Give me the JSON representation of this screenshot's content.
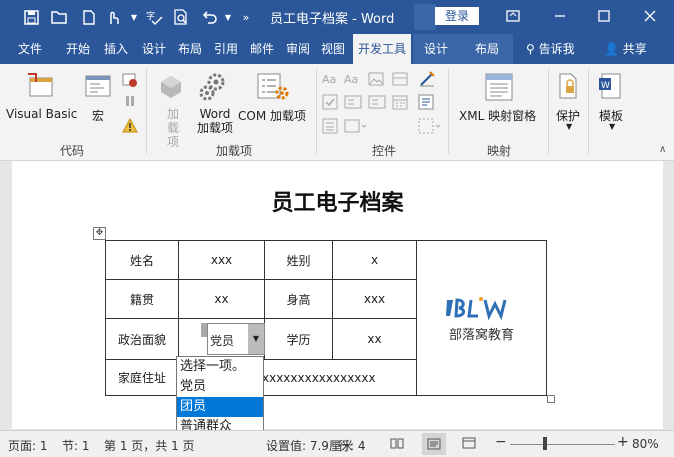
{
  "window": {
    "title": "员工电子档案  -  Word",
    "login": "登录",
    "accent": "#2b579a"
  },
  "tabs": [
    "文件",
    "开始",
    "插入",
    "设计",
    "布局",
    "引用",
    "邮件",
    "审阅",
    "视图",
    "开发工具",
    "设计",
    "布局"
  ],
  "tell_me": "告诉我",
  "share": "共享",
  "ribbon": {
    "code": {
      "label": "代码",
      "visual_basic": "Visual Basic",
      "macro": "宏"
    },
    "addins": {
      "label": "加载项",
      "addins": "加\n载项",
      "word_addins": "Word\n加载项",
      "com_addins": "COM 加载项"
    },
    "controls": {
      "label": "控件"
    },
    "mapping": {
      "label": "映射",
      "xml_pane": "XML 映射窗格"
    },
    "protect": {
      "label": "保护"
    },
    "templates": {
      "label": "模板"
    }
  },
  "document": {
    "heading": "员工电子档案",
    "rows": [
      {
        "l1": "姓名",
        "v1": "xxx",
        "l2": "姓别",
        "v2": "x"
      },
      {
        "l1": "籍贯",
        "v1": "xx",
        "l2": "身高",
        "v2": "xxx"
      },
      {
        "l1": "政治面貌",
        "v1": "党员",
        "l2": "学历",
        "v2": "xx"
      },
      {
        "l1": "家庭住址",
        "v1": "xxxxxxxxxxxxxxxxxxxxxx"
      }
    ],
    "logo_text": "部落窝教育"
  },
  "dropdown": {
    "options": [
      "选择一项。",
      "党员",
      "团员",
      "普通群众"
    ],
    "highlighted": "团员"
  },
  "status": {
    "page": "页面: 1",
    "section": "节: 1",
    "pages": "第 1 页，共 1 页",
    "position": "设置值: 7.9厘米",
    "line": "行: 4",
    "zoom": "80%"
  }
}
